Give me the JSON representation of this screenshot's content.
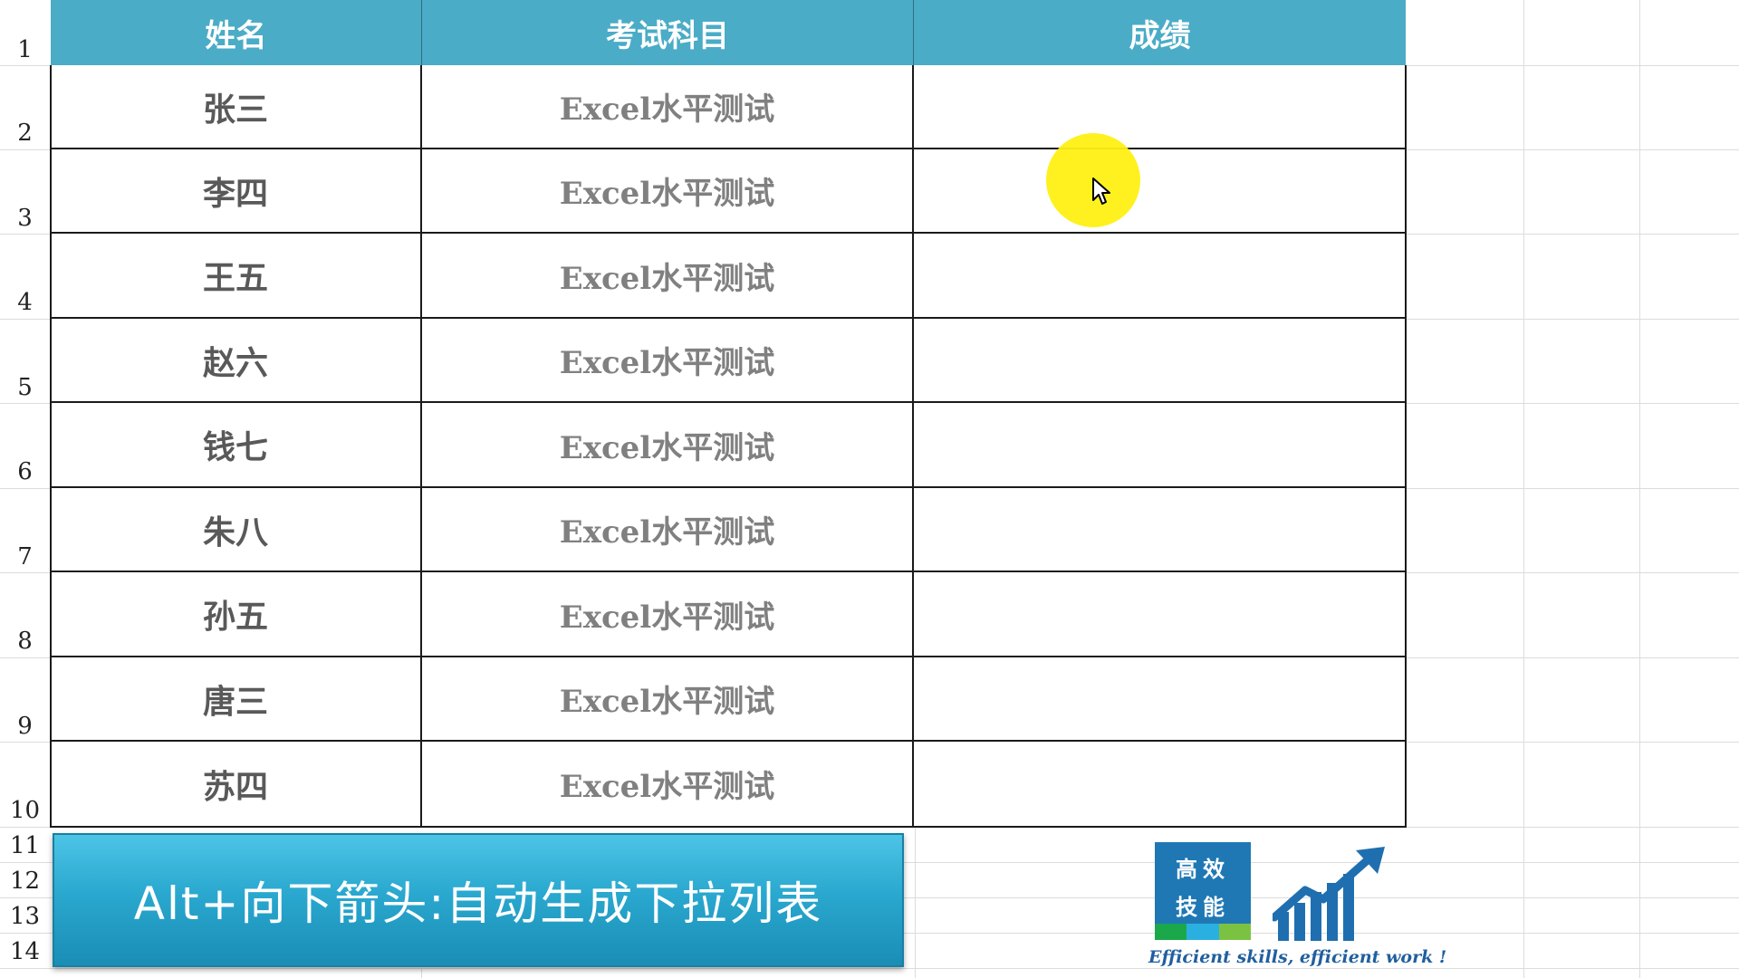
{
  "spreadsheet": {
    "row_numbers": [
      "1",
      "2",
      "3",
      "4",
      "5",
      "6",
      "7",
      "8",
      "9",
      "10",
      "11",
      "12",
      "13",
      "14"
    ],
    "headers": {
      "name": "姓名",
      "subject": "考试科目",
      "score": "成绩"
    },
    "rows": [
      {
        "name": "张三",
        "subject": "Excel水平测试",
        "score": ""
      },
      {
        "name": "李四",
        "subject": "Excel水平测试",
        "score": ""
      },
      {
        "name": "王五",
        "subject": "Excel水平测试",
        "score": ""
      },
      {
        "name": "赵六",
        "subject": "Excel水平测试",
        "score": ""
      },
      {
        "name": "钱七",
        "subject": "Excel水平测试",
        "score": ""
      },
      {
        "name": "朱八",
        "subject": "Excel水平测试",
        "score": ""
      },
      {
        "name": "孙五",
        "subject": "Excel水平测试",
        "score": ""
      },
      {
        "name": "唐三",
        "subject": "Excel水平测试",
        "score": ""
      },
      {
        "name": "苏四",
        "subject": "Excel水平测试",
        "score": ""
      }
    ]
  },
  "banner": {
    "text": "Alt+向下箭头:自动生成下拉列表"
  },
  "logo": {
    "line1": "高效",
    "line2": "技能",
    "slogan": "Efficient skills, efficient work !"
  },
  "colors": {
    "header_bg": "#4aacc6",
    "banner_bg": "#2aa8cf",
    "cursor_highlight": "#fff014",
    "logo_blue": "#1f78b4"
  },
  "icons": {
    "cursor": "mouse-pointer-icon",
    "logo_chart": "growth-chart-icon"
  }
}
